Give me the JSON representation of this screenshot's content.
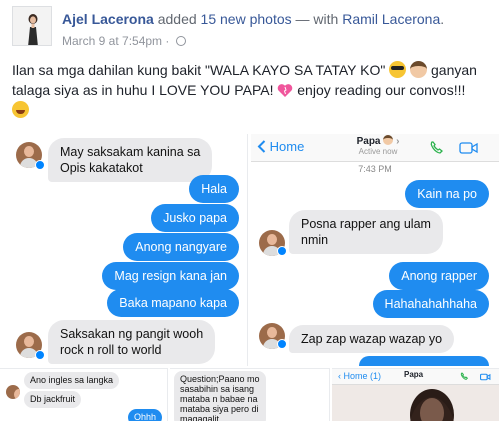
{
  "post": {
    "author": "Ajel Lacerona",
    "action": " added ",
    "photo_count": "15 new photos",
    "with_text": " — with ",
    "tagged": "Ramil Lacerona",
    "period": ".",
    "timestamp": "March 9 at 7:54pm",
    "separator": " · ",
    "caption_part1": "Ilan sa mga dahilan kung bakit \"WALA KAYO SA TATAY KO\" ",
    "caption_part2": " ganyan talaga siya as in huhu I LOVE YOU PAPA! ",
    "caption_part3": " enjoy reading our convos!!!",
    "emoji": [
      "sunglasses-emoji",
      "man-emoji",
      "heart-emoji",
      "laughing-emoji"
    ]
  },
  "photo1": {
    "messages": [
      {
        "dir": "in",
        "text": "May saksakam kanina sa"
      },
      {
        "dir": "in",
        "text": "Opis kakatakot"
      },
      {
        "dir": "out",
        "text": "Hala"
      },
      {
        "dir": "out",
        "text": "Jusko papa"
      },
      {
        "dir": "out",
        "text": "Anong nangyare"
      },
      {
        "dir": "out",
        "text": "Mag resign kana jan"
      },
      {
        "dir": "out",
        "text": "Baka mapano kapa"
      },
      {
        "dir": "in",
        "text": "Saksakan ng pangit wooh"
      },
      {
        "dir": "in",
        "text": "rock n roll to  world"
      }
    ]
  },
  "photo2": {
    "back_label": "Home",
    "contact_name": "Papa",
    "status": "Active now",
    "time": "7:43 PM",
    "messages": [
      {
        "dir": "out",
        "text": "Kain na po"
      },
      {
        "dir": "in",
        "text": "Posna rapper ang ulam"
      },
      {
        "dir": "in",
        "text": "nmin"
      },
      {
        "dir": "out",
        "text": "Anong rapper"
      },
      {
        "dir": "out",
        "text": "Hahahahahhaha"
      },
      {
        "dir": "in",
        "text": "Zap zap wazap wazap yo"
      }
    ]
  },
  "photo3": {
    "messages": [
      {
        "dir": "in",
        "text": "Ano ingles sa langka"
      },
      {
        "dir": "in",
        "text": "Db jackfruit"
      },
      {
        "dir": "out",
        "text": "Ohhh"
      }
    ]
  },
  "photo4": {
    "messages": [
      {
        "dir": "in",
        "text": "Question;Paano mo"
      },
      {
        "dir": "in",
        "text": "sasabihin sa isang"
      },
      {
        "dir": "in",
        "text": "mataba n babae na"
      },
      {
        "dir": "in",
        "text": "mataba siya pero di"
      },
      {
        "dir": "in",
        "text": "magagalit"
      }
    ]
  },
  "photo5": {
    "back_label": "Home (1)",
    "contact_name": "Papa"
  },
  "colors": {
    "link": "#385898",
    "bubble_out": "#1f8cf0",
    "bubble_in": "#e9e9eb"
  }
}
